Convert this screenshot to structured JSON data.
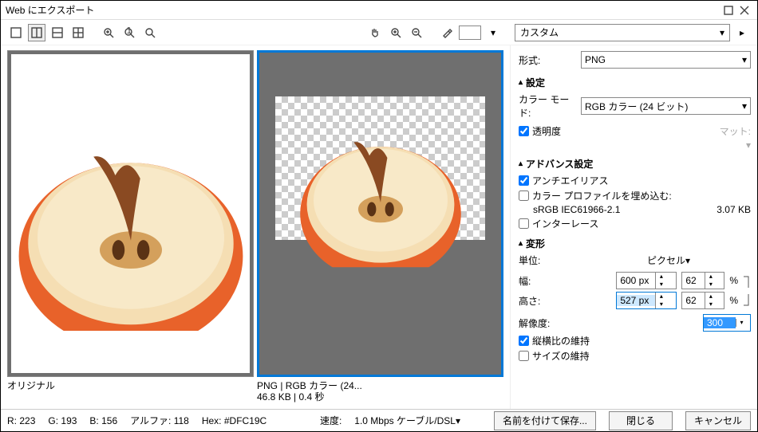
{
  "window": {
    "title": "Web にエクスポート"
  },
  "toolbar": {
    "preset": "カスタム"
  },
  "preview": {
    "original_label": "オリジナル",
    "export_label_line1": "PNG  |  RGB カラー (24...",
    "export_label_line2": "46.8 KB  |  0.4 秒"
  },
  "panel": {
    "format_label": "形式:",
    "format_value": "PNG",
    "section_settings": "設定",
    "color_mode_label": "カラー モード:",
    "color_mode_value": "RGB カラー (24 ビット)",
    "transparency_label": "透明度",
    "matte_label": "マット:",
    "section_advanced": "アドバンス設定",
    "antialias_label": "アンチエイリアス",
    "embed_profile_label": "カラー プロファイルを埋め込む:",
    "profile_name": "sRGB IEC61966-2.1",
    "profile_size": "3.07 KB",
    "interlace_label": "インターレース",
    "section_transform": "変形",
    "units_label": "単位:",
    "units_value": "ピクセル",
    "width_label": "幅:",
    "width_px": "600 px",
    "width_pct": "62",
    "height_label": "高さ:",
    "height_px": "527 px",
    "height_pct": "62",
    "pct_sym": "%",
    "resolution_label": "解像度:",
    "resolution_value": "300",
    "keep_aspect_label": "縦横比の維持",
    "keep_size_label": "サイズの維持"
  },
  "status": {
    "r_label": "R:",
    "r_val": "223",
    "g_label": "G:",
    "g_val": "193",
    "b_label": "B:",
    "b_val": "156",
    "alpha_label": "アルファ:",
    "alpha_val": "118",
    "hex_label": "Hex:",
    "hex_val": "#DFC19C"
  },
  "footer": {
    "speed_label": "速度:",
    "speed_value": "1.0 Mbps ケーブル/DSL",
    "save_as": "名前を付けて保存...",
    "close": "閉じる",
    "cancel": "キャンセル"
  }
}
